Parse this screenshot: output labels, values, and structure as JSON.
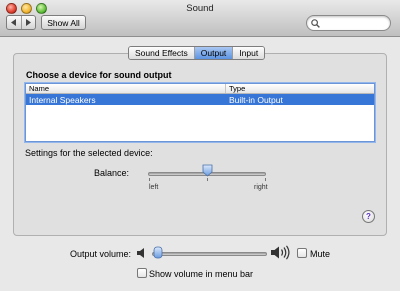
{
  "window": {
    "title": "Sound"
  },
  "toolbar": {
    "back_icon": "chevron-left-icon",
    "forward_icon": "chevron-right-icon",
    "show_all_label": "Show All",
    "search": {
      "value": "",
      "placeholder": "",
      "icon": "magnifier-icon"
    }
  },
  "tabs": [
    {
      "label": "Sound Effects",
      "active": false
    },
    {
      "label": "Output",
      "active": true
    },
    {
      "label": "Input",
      "active": false
    }
  ],
  "device_section": {
    "title": "Choose a device for sound output",
    "columns": [
      "Name",
      "Type"
    ],
    "rows": [
      {
        "name": "Internal Speakers",
        "type": "Built-in Output",
        "selected": true
      }
    ]
  },
  "settings": {
    "title": "Settings for the selected device:",
    "balance": {
      "label": "Balance:",
      "left_label": "left",
      "right_label": "right",
      "value": 0.5
    }
  },
  "help_label": "?",
  "output_volume": {
    "label": "Output volume:",
    "value": 0.05,
    "low_icon": "speaker-low-icon",
    "high_icon": "speaker-high-icon",
    "mute_label": "Mute",
    "mute_checked": false
  },
  "show_volume": {
    "label": "Show volume in menu bar",
    "checked": false
  },
  "colors": {
    "selection": "#3775d6",
    "tab_active": "#5c94e3",
    "help_accent": "#5b30c8"
  }
}
